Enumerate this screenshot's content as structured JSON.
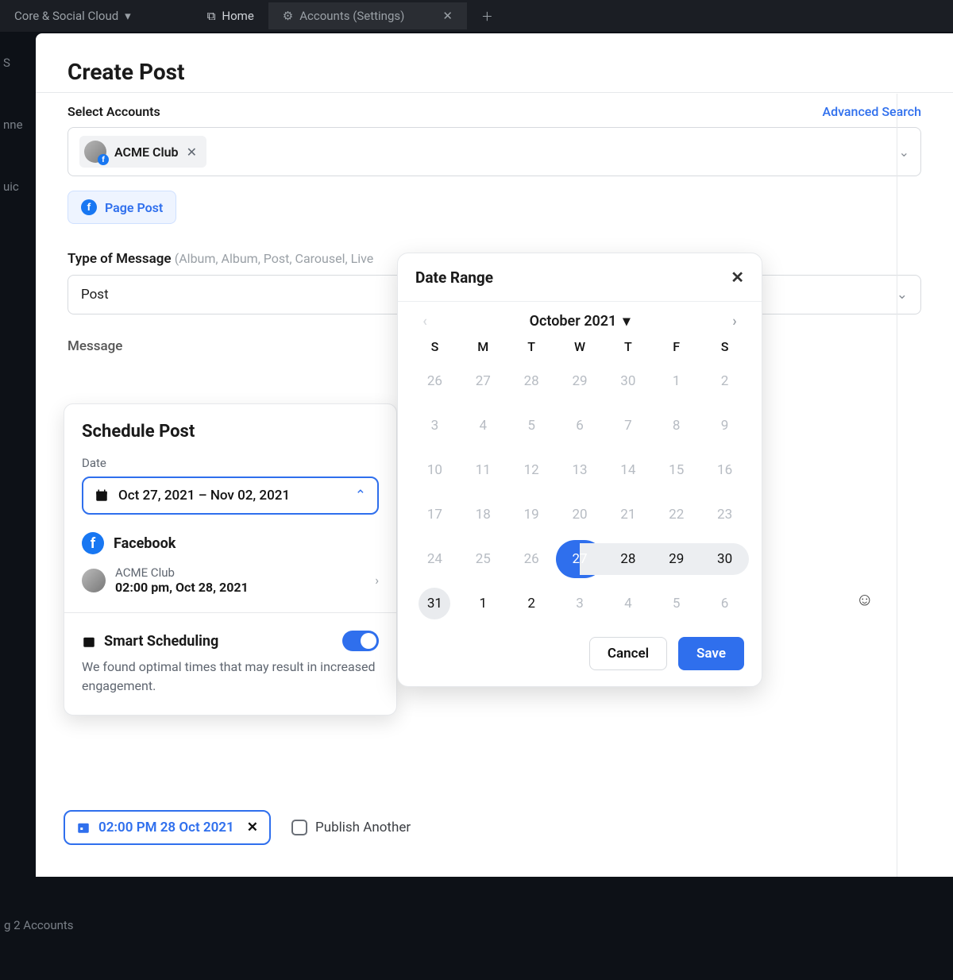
{
  "bg": {
    "workspace": "Core & Social Cloud",
    "home_tab": "Home",
    "accounts_tab": "Accounts (Settings)",
    "footer": "g 2 Accounts",
    "sidebar": [
      "S",
      "nne",
      "uic"
    ]
  },
  "header": {
    "title": "Create Post"
  },
  "select_accounts": {
    "label": "Select Accounts",
    "advanced": "Advanced Search",
    "chip_name": "ACME Club"
  },
  "page_post": {
    "label": "Page Post"
  },
  "type_of_message": {
    "label": "Type of Message",
    "hint": "(Album, Album, Post, Carousel, Live",
    "value": "Post"
  },
  "message": {
    "label": "Message"
  },
  "schedule": {
    "title": "Schedule Post",
    "date_label": "Date",
    "date_range": "Oct 27, 2021 – Nov 02, 2021",
    "network": "Facebook",
    "account": {
      "name": "ACME Club",
      "when": "02:00 pm, Oct 28, 2021"
    },
    "smart_title": "Smart Scheduling",
    "smart_desc": "We found optimal times that may result in increased engagement."
  },
  "daterange": {
    "title": "Date Range",
    "month": "October 2021",
    "dow": [
      "S",
      "M",
      "T",
      "W",
      "T",
      "F",
      "S"
    ],
    "weeks": [
      [
        {
          "n": "26"
        },
        {
          "n": "27"
        },
        {
          "n": "28"
        },
        {
          "n": "29"
        },
        {
          "n": "30"
        },
        {
          "n": "1"
        },
        {
          "n": "2"
        }
      ],
      [
        {
          "n": "3"
        },
        {
          "n": "4"
        },
        {
          "n": "5"
        },
        {
          "n": "6"
        },
        {
          "n": "7"
        },
        {
          "n": "8"
        },
        {
          "n": "9"
        }
      ],
      [
        {
          "n": "10"
        },
        {
          "n": "11"
        },
        {
          "n": "12"
        },
        {
          "n": "13"
        },
        {
          "n": "14"
        },
        {
          "n": "15"
        },
        {
          "n": "16"
        }
      ],
      [
        {
          "n": "17"
        },
        {
          "n": "18"
        },
        {
          "n": "19"
        },
        {
          "n": "20"
        },
        {
          "n": "21"
        },
        {
          "n": "22"
        },
        {
          "n": "23"
        }
      ],
      [
        {
          "n": "24"
        },
        {
          "n": "25"
        },
        {
          "n": "26"
        },
        {
          "n": "27",
          "state": "sel-start"
        },
        {
          "n": "28",
          "state": "range cur"
        },
        {
          "n": "29",
          "state": "range cur"
        },
        {
          "n": "30",
          "state": "range range-last cur"
        }
      ],
      [
        {
          "n": "31",
          "state": "grey cur"
        },
        {
          "n": "1",
          "state": "cur"
        },
        {
          "n": "2",
          "state": "cur"
        },
        {
          "n": "3"
        },
        {
          "n": "4"
        },
        {
          "n": "5"
        },
        {
          "n": "6"
        }
      ]
    ],
    "cancel": "Cancel",
    "save": "Save"
  },
  "bottom": {
    "scheduled": "02:00 PM 28 Oct 2021",
    "publish_another": "Publish Another"
  }
}
